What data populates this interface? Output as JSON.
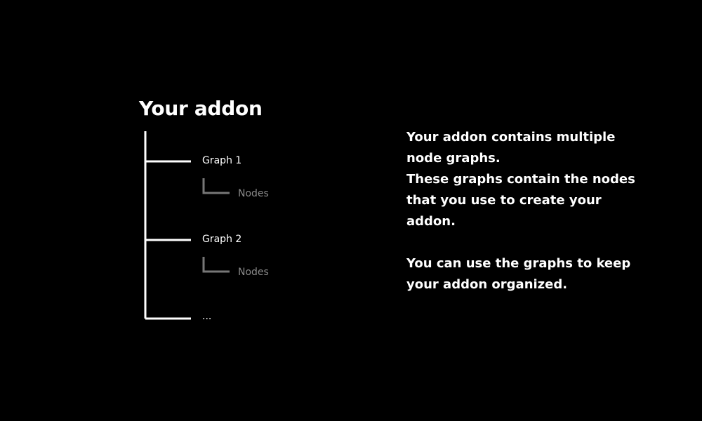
{
  "title": "Your addon",
  "tree": {
    "items": [
      {
        "label": "Graph 1",
        "child": "Nodes"
      },
      {
        "label": "Graph 2",
        "child": "Nodes"
      }
    ],
    "ellipsis": "..."
  },
  "description": {
    "line1": "Your addon contains multiple",
    "line2": "node graphs.",
    "line3": "These graphs contain the nodes",
    "line4": "that you use to create your",
    "line5": "addon.",
    "line6": "You can use the graphs to keep",
    "line7": "your addon organized."
  },
  "colors": {
    "background": "#000000",
    "primary_text": "#ffffff",
    "muted_text": "#8a8a8a",
    "muted_line": "#777777"
  }
}
